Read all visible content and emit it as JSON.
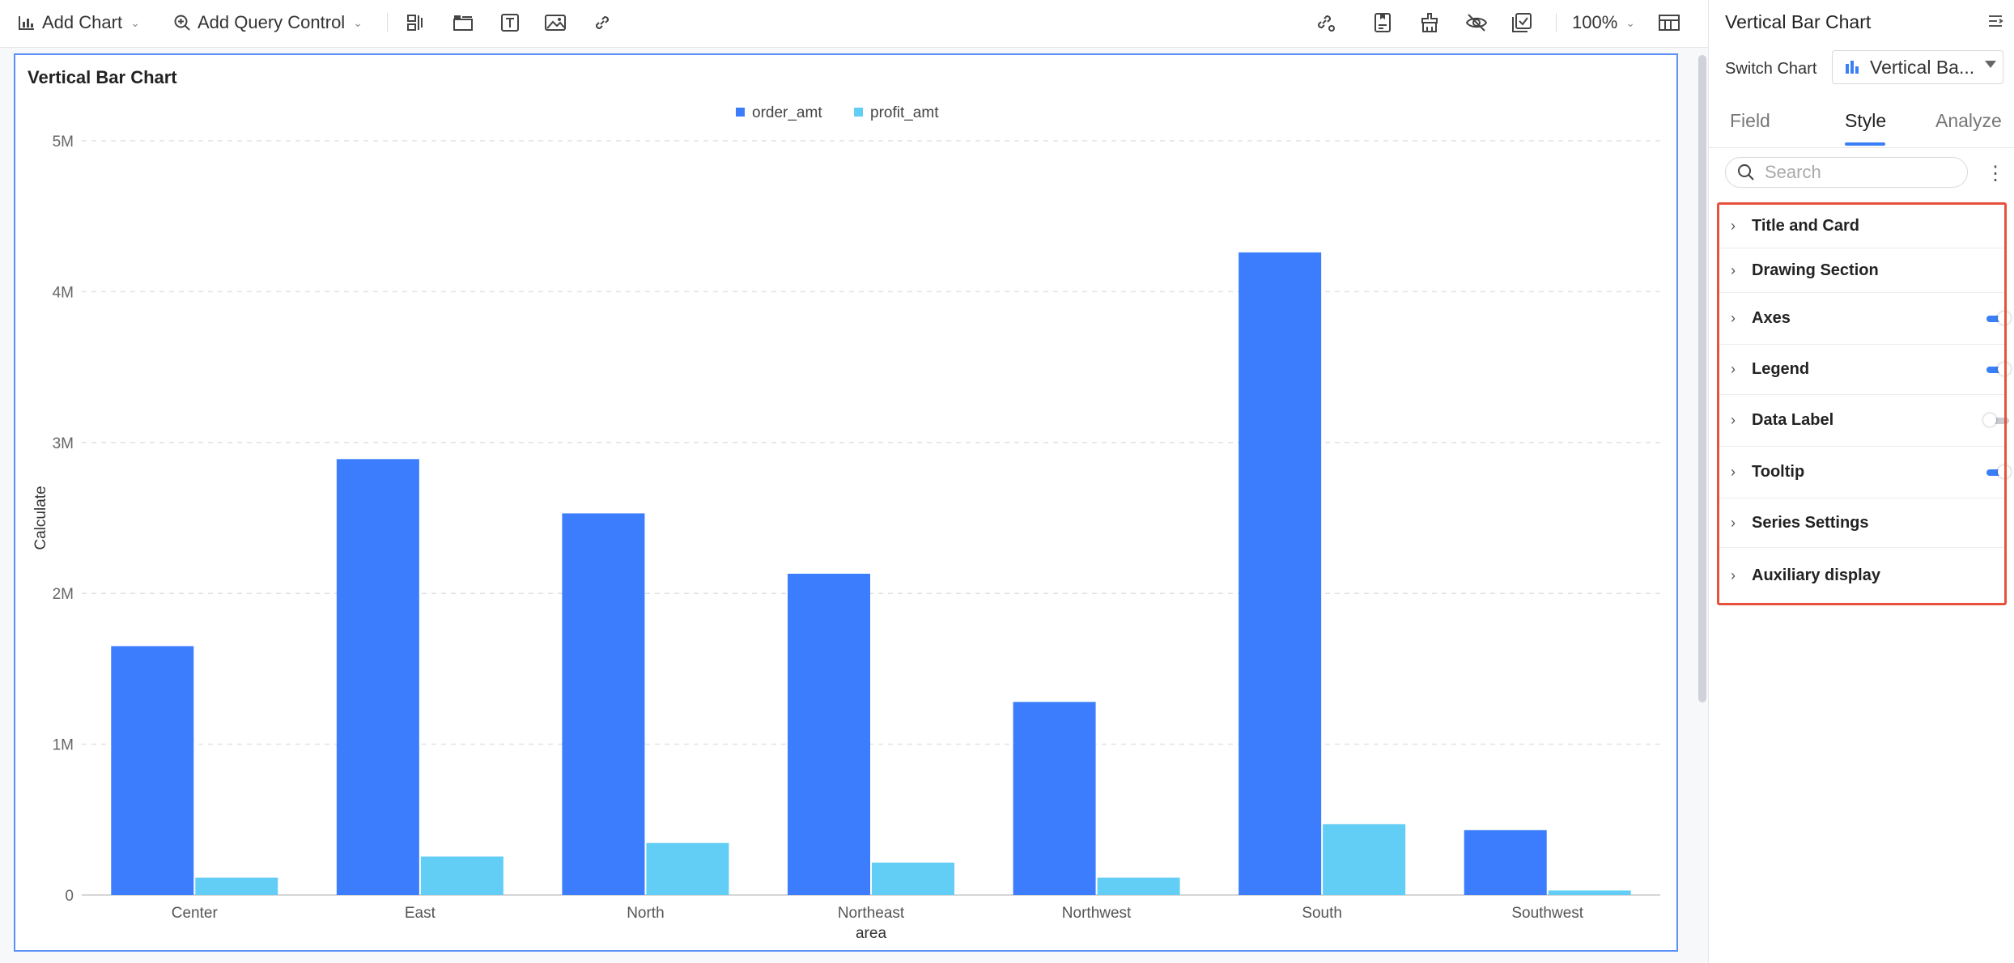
{
  "toolbar": {
    "add_chart": "Add Chart",
    "add_query_control": "Add Query Control",
    "zoom": "100%"
  },
  "panel": {
    "title": "Vertical Bar Chart",
    "switch_chart_label": "Switch Chart",
    "switch_chart_value": "Vertical Ba...",
    "tabs": [
      {
        "label": "Field"
      },
      {
        "label": "Style"
      },
      {
        "label": "Analyze"
      }
    ],
    "active_tab": "Style",
    "search_placeholder": "Search",
    "sections": [
      {
        "label": "Title and Card",
        "toggle": null
      },
      {
        "label": "Drawing Section",
        "toggle": null
      },
      {
        "label": "Axes",
        "toggle": true
      },
      {
        "label": "Legend",
        "toggle": true
      },
      {
        "label": "Data Label",
        "toggle": false
      },
      {
        "label": "Tooltip",
        "toggle": true
      },
      {
        "label": "Series Settings",
        "toggle": null
      },
      {
        "label": "Auxiliary display",
        "toggle": null
      }
    ],
    "accent_color": "#3b7ff6",
    "highlight_color": "#e8503c"
  },
  "chart_data": {
    "type": "bar",
    "title": "Vertical Bar Chart",
    "xlabel": "area",
    "ylabel": "Calculate",
    "categories": [
      "Center",
      "East",
      "North",
      "Northeast",
      "Northwest",
      "South",
      "Southwest"
    ],
    "series": [
      {
        "name": "order_amt",
        "color": "#3b7dfd",
        "values": [
          1650000,
          2890000,
          2530000,
          2130000,
          1280000,
          4260000,
          430000
        ]
      },
      {
        "name": "profit_amt",
        "color": "#62cdf5",
        "values": [
          115000,
          255000,
          345000,
          215000,
          115000,
          470000,
          30000
        ]
      }
    ],
    "ylim": [
      0,
      5000000
    ],
    "yticks": [
      {
        "value": 0,
        "label": "0"
      },
      {
        "value": 1000000,
        "label": "1M"
      },
      {
        "value": 2000000,
        "label": "2M"
      },
      {
        "value": 3000000,
        "label": "3M"
      },
      {
        "value": 4000000,
        "label": "4M"
      },
      {
        "value": 5000000,
        "label": "5M"
      }
    ],
    "grid": true,
    "legend_position": "top-center"
  }
}
